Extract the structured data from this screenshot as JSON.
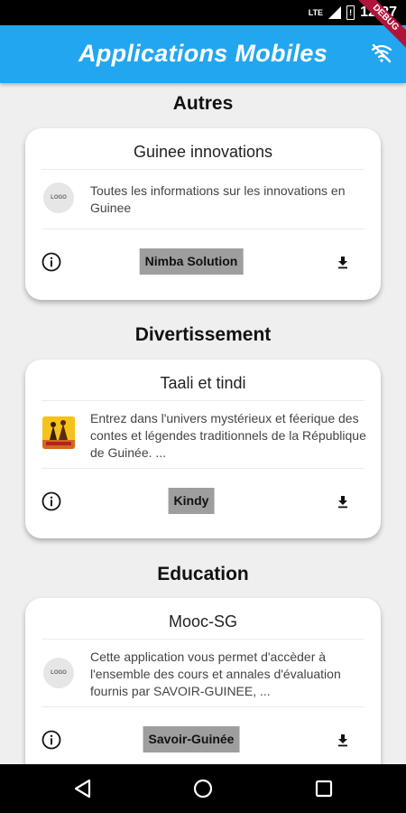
{
  "status_bar": {
    "network": "LTE",
    "battery_label": "!",
    "time": "12:27"
  },
  "app_bar": {
    "title": "Applications Mobiles",
    "action_icon": "wifi-off-icon",
    "debug_label": "DEBUG"
  },
  "sections": [
    {
      "title": "Autres",
      "app": {
        "name": "Guinee innovations",
        "logo_text": "LOGO",
        "description": "Toutes les informations sur les innovations en Guinee",
        "publisher": "Nimba Solution"
      }
    },
    {
      "title": "Divertissement",
      "app": {
        "name": "Taali et tindi",
        "logo_text": "",
        "description": "Entrez dans l'univers mystérieux et féerique des contes et légendes traditionnels de la République de Guinée. ...",
        "publisher": "Kindy"
      }
    },
    {
      "title": "Education",
      "app": {
        "name": "Mooc-SG",
        "logo_text": "LOGO",
        "description": "Cette application vous permet d'accèder à l'ensemble des cours et annales d'évaluation fournis par SAVOIR-GUINEE, ...",
        "publisher": "Savoir-Guinée"
      }
    }
  ],
  "colors": {
    "app_bar": "#22a6f0",
    "background": "#efefef",
    "publisher_chip": "#9e9e9e",
    "debug_ribbon": "#b0143a"
  }
}
